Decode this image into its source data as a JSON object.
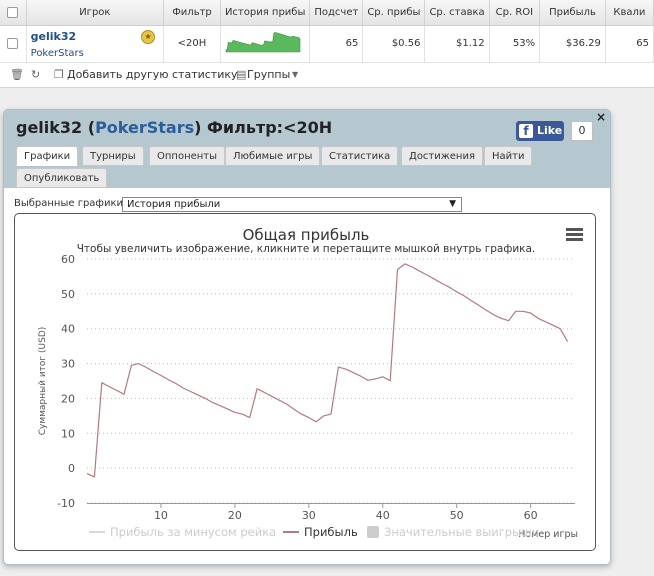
{
  "table": {
    "headers": [
      "",
      "Игрок",
      "Фильтр",
      "История прибы",
      "Подсчет",
      "Ср. прибы",
      "Ср. ставка",
      "Ср. ROI",
      "Прибыль",
      "Квали"
    ],
    "row": {
      "player": "gelik32",
      "site": "PokerStars",
      "filter": "<20H",
      "count": "65",
      "avg_profit": "$0.56",
      "avg_stake": "$1.12",
      "avg_roi": "53%",
      "profit": "$36.29",
      "qualified": "65"
    }
  },
  "toolbar": {
    "add_stats": "Добавить другую статистику",
    "groups": "Группы"
  },
  "dialog": {
    "title_player": "gelik32",
    "title_open": "(",
    "title_site": "PokerStars",
    "title_close": ")",
    "title_filter": "Фильтр:<20H",
    "fb_like": "Like",
    "fb_count": "0",
    "close": "×",
    "tabs": [
      "Графики",
      "Турниры",
      "Оппоненты",
      "Любимые игры",
      "Статистика",
      "Достижения",
      "Найти",
      "Опубликовать"
    ],
    "select_label": "Выбранные графики:",
    "select_value": "История прибыли"
  },
  "chart_data": {
    "type": "line",
    "title": "Общая прибыль",
    "subtitle": "Чтобы увеличить изображение, кликните и перетащите мышкой внутрь графика.",
    "xlabel": "Номер игры",
    "ylabel": "Суммарный итог (USD)",
    "xlim": [
      0,
      66
    ],
    "ylim": [
      -10,
      60
    ],
    "xticks": [
      10,
      20,
      30,
      40,
      50,
      60
    ],
    "yticks": [
      -10,
      0,
      10,
      20,
      30,
      40,
      50,
      60
    ],
    "grid": true,
    "legend": "bottom",
    "legend_items": [
      "Прибыль за минусом рейка",
      "Прибыль",
      "Значительные выигрыши"
    ],
    "series": [
      {
        "name": "Прибыль",
        "color": "#b57a7e",
        "x": [
          0,
          1,
          2,
          3,
          4,
          5,
          6,
          7,
          8,
          9,
          10,
          11,
          12,
          13,
          14,
          15,
          16,
          17,
          18,
          19,
          20,
          21,
          22,
          23,
          24,
          25,
          26,
          27,
          28,
          29,
          30,
          31,
          32,
          33,
          34,
          35,
          36,
          37,
          38,
          39,
          40,
          41,
          42,
          43,
          44,
          45,
          46,
          47,
          48,
          49,
          50,
          51,
          52,
          53,
          54,
          55,
          56,
          57,
          58,
          59,
          60,
          61,
          62,
          63,
          64,
          65
        ],
        "values": [
          -1.5,
          -2.5,
          24.5,
          23.4,
          22.3,
          21.2,
          29.5,
          30.0,
          28.9,
          27.7,
          26.6,
          25.4,
          24.3,
          23.0,
          22.0,
          21.0,
          20.0,
          18.8,
          17.9,
          17.0,
          16.0,
          15.5,
          14.5,
          22.8,
          21.7,
          20.6,
          19.5,
          18.4,
          16.9,
          15.5,
          14.5,
          13.3,
          15.0,
          15.5,
          29.0,
          28.4,
          27.4,
          26.4,
          25.2,
          25.6,
          26.2,
          25.1,
          57.0,
          58.6,
          57.7,
          56.5,
          55.4,
          54.2,
          53.0,
          51.9,
          50.6,
          49.4,
          48.0,
          46.7,
          45.3,
          44.0,
          43.0,
          42.3,
          45.0,
          45.0,
          44.5,
          43.0,
          42.0,
          41.0,
          40.0,
          36.3
        ]
      }
    ]
  }
}
